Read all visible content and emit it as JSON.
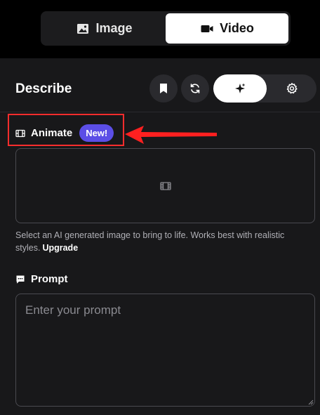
{
  "mode_switch": {
    "image_label": "Image",
    "video_label": "Video",
    "selected": "Video"
  },
  "panel": {
    "title": "Describe",
    "header_buttons": [
      "bookmark-icon",
      "refresh-icon",
      "magic-sparkle-icon",
      "gear-icon"
    ]
  },
  "animate": {
    "label": "Animate",
    "badge": "New!",
    "drop_zone_icon": "film-icon",
    "help_text": "Select an AI generated image to bring to life. Works best with realistic styles.",
    "upgrade_label": "Upgrade"
  },
  "prompt": {
    "label": "Prompt",
    "placeholder": "Enter your prompt",
    "value": ""
  },
  "annotation": {
    "highlight_color": "#ff2d2d"
  },
  "colors": {
    "background": "#000000",
    "panel": "#18181a",
    "accent_badge": "#5b4ee6"
  }
}
